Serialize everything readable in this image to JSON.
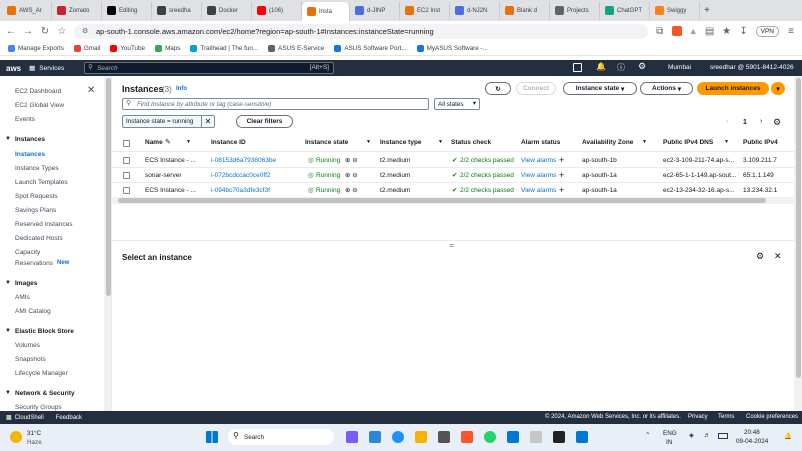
{
  "browser": {
    "tabs": [
      {
        "label": "AWS_Ar",
        "color": "#e8710a"
      },
      {
        "label": "Zomato",
        "color": "#cb202d"
      },
      {
        "label": "Editing",
        "color": "#000000"
      },
      {
        "label": "sreedha",
        "color": "#3c4043"
      },
      {
        "label": "Docker",
        "color": "#3c4043"
      },
      {
        "label": "(106)",
        "color": "#ff0000"
      },
      {
        "label": "Insta",
        "color": "#e8710a",
        "active": true
      },
      {
        "label": "d-JINP",
        "color": "#4a6ee0"
      },
      {
        "label": "EC2 Inst",
        "color": "#e8710a"
      },
      {
        "label": "d-NJ2N",
        "color": "#4a6ee0"
      },
      {
        "label": "Blank d",
        "color": "#e8710a"
      },
      {
        "label": "Projects",
        "color": "#5f6368"
      },
      {
        "label": "ChatGPT",
        "color": "#10a37f"
      },
      {
        "label": "Swiggy",
        "color": "#fc8019"
      }
    ],
    "url": "ap-south-1.console.aws.amazon.com/ec2/home?region=ap-south-1#Instances:instanceState=running",
    "vpn": "VPN",
    "bookmarks": [
      "Manage Exports",
      "Gmail",
      "YouTube",
      "Maps",
      "Trailhead | The fun...",
      "ASUS E-Service",
      "ASUS Software Port...",
      "MyASUS Software -..."
    ]
  },
  "awsnav": {
    "logo": "aws",
    "services": "Services",
    "search_placeholder": "Search",
    "search_shortcut": "[Alt+S]",
    "region": "Mumbai",
    "account": "sreedhar @ 5901-8412-4026"
  },
  "sidebar": {
    "top_items": [
      "EC2 Dashboard",
      "EC2 Global View",
      "Events"
    ],
    "instances_head": "Instances",
    "instances_items": [
      "Instances",
      "Instance Types",
      "Launch Templates",
      "Spot Requests",
      "Savings Plans",
      "Reserved Instances",
      "Dedicated Hosts",
      "Capacity",
      "Reservations"
    ],
    "new_badge": "New",
    "images_head": "Images",
    "images_items": [
      "AMIs",
      "AMI Catalog"
    ],
    "ebs_head": "Elastic Block Store",
    "ebs_items": [
      "Volumes",
      "Snapshots",
      "Lifecycle Manager"
    ],
    "network_head": "Network & Security",
    "network_items": [
      "Security Groups"
    ]
  },
  "main": {
    "title": "Instances",
    "count": "(3)",
    "info": "Info",
    "connect": "Connect",
    "instance_state": "Instance state",
    "actions": "Actions",
    "launch": "Launch instances",
    "filter_placeholder": "Find Instance by attribute or tag (case-sensitive)",
    "states_select": "All states",
    "chip": "Instance state = running",
    "clear_filters": "Clear filters",
    "page": "1",
    "columns": [
      "Name",
      "Instance ID",
      "Instance state",
      "Instance type",
      "Status check",
      "Alarm status",
      "Availability Zone",
      "Public IPv4 DNS",
      "Public IPv4"
    ],
    "rows": [
      {
        "name": "ECS Instance - ...",
        "id": "i-08153d6a7938063be",
        "state": "Running",
        "type": "t2.medium",
        "status": "2/2 checks passed",
        "alarm": "View alarms",
        "az": "ap-south-1b",
        "dns": "ec2-3-109-211-74.ap-s...",
        "ip": "3.109.211.7"
      },
      {
        "name": "sonar-server",
        "id": "i-072bcdccac0ce0ff2",
        "state": "Running",
        "type": "t2.medium",
        "status": "2/2 checks passed",
        "alarm": "View alarms",
        "az": "ap-south-1a",
        "dns": "ec2-65-1-1-149.ap-sout...",
        "ip": "65.1.1.149"
      },
      {
        "name": "ECS Instance - ...",
        "id": "i-094bc70a3dfe3cf3f",
        "state": "Running",
        "type": "t2.medium",
        "status": "2/2 checks passed",
        "alarm": "View alarms",
        "az": "ap-south-1a",
        "dns": "ec2-13-234-32-16.ap-s...",
        "ip": "13.234.32.1"
      }
    ],
    "detail_title": "Select an instance"
  },
  "footer": {
    "cloudshell": "CloudShell",
    "feedback": "Feedback",
    "copyright": "© 2024, Amazon Web Services, Inc. or its affiliates.",
    "privacy": "Privacy",
    "terms": "Terms",
    "cookies": "Cookie preferences"
  },
  "taskbar": {
    "weather_temp": "31°C",
    "weather_desc": "Haze",
    "search": "Search",
    "lang1": "ENG",
    "lang2": "IN",
    "time": "20:48",
    "date": "09-04-2024"
  }
}
